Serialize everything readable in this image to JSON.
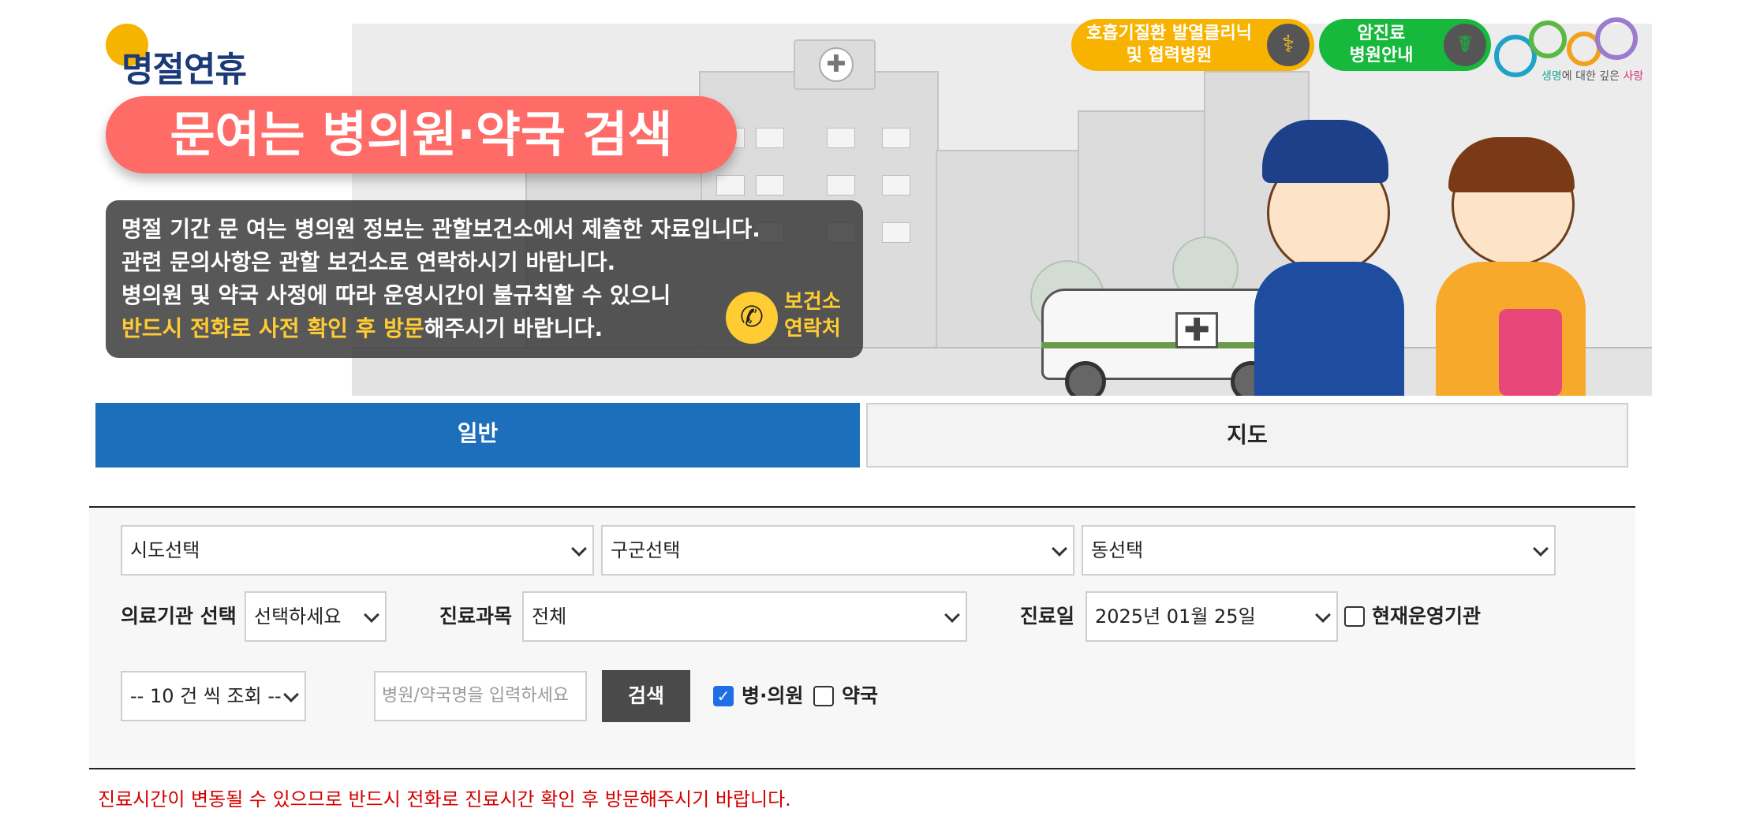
{
  "banner": {
    "logo_text": "명절연휴",
    "title": "문여는 병의원·약국 검색",
    "info_lines": [
      "명절 기간 문 여는 병의원 정보는 관할보건소에서 제출한 자료입니다.",
      "관련 문의사항은 관할 보건소로 연락하시기 바랍니다.",
      "병의원 및 약국 사정에 따라 운영시간이 불규칙할 수 있으니"
    ],
    "info_highlight": "반드시 전화로 사전 확인 후 방문",
    "info_tail": "해주시기 바랍니다.",
    "contact_button": {
      "line1": "보건소",
      "line2": "연락처"
    },
    "top_links": [
      {
        "line1": "호흡기질환 발열클리닉",
        "line2": "및 협력병원",
        "color": "#f8b300",
        "icon": "lungs-icon"
      },
      {
        "line1": "암진료",
        "line2": "병원안내",
        "color": "#17b93c",
        "icon": "stethoscope-icon"
      }
    ],
    "egen_logo": {
      "tag_prefix": "생명",
      "tag_mid": "에 대한 깊은 ",
      "tag_suffix": "사랑"
    }
  },
  "tabs": [
    {
      "label": "일반",
      "active": true
    },
    {
      "label": "지도",
      "active": false
    }
  ],
  "search": {
    "sido": "시도선택",
    "gugun": "구군선택",
    "dong": "동선택",
    "institution_label": "의료기관 선택",
    "institution_value": "선택하세요",
    "department_label": "진료과목",
    "department_value": "전체",
    "date_label": "진료일",
    "date_value": "2025년 01월 25일",
    "currently_open_label": "현재운영기관",
    "currently_open_checked": false,
    "page_size": "-- 10 건 씩 조회 --",
    "name_placeholder": "병원/약국명을 입력하세요",
    "search_button": "검색",
    "hospital_label": "병·의원",
    "hospital_checked": true,
    "pharmacy_label": "약국",
    "pharmacy_checked": false
  },
  "notice": "진료시간이 변동될 수 있으므로 반드시 전화로 진료시간 확인 후 방문해주시기 바랍니다.",
  "colors": {
    "tab_active": "#1d6fbb",
    "title_pill": "#ff6b66",
    "notice": "#d40000",
    "highlight": "#ffcc33"
  }
}
